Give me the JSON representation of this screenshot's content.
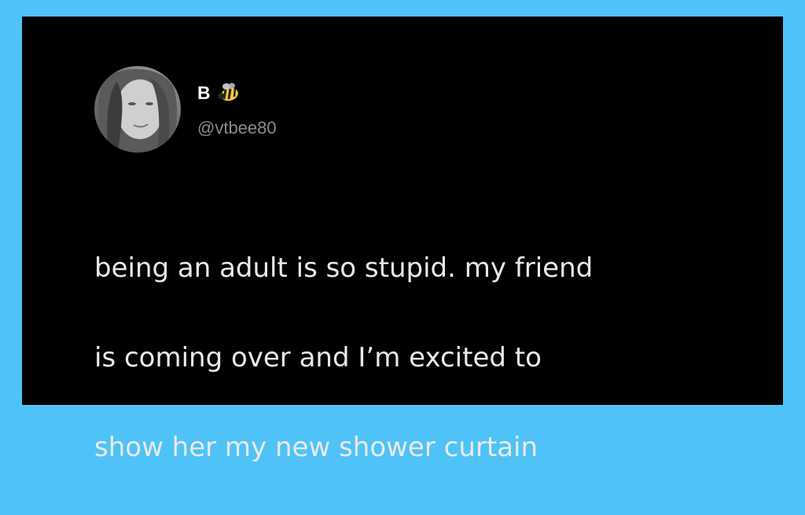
{
  "tweet": {
    "display_name": "B",
    "name_badge_icon": "bee-icon",
    "handle": "@vtbee80",
    "avatar_icon": "avatar-photo",
    "text_lines": [
      "being an adult is so stupid. my friend",
      "is coming over and I’m excited to",
      "show her my new shower curtain"
    ]
  },
  "colors": {
    "frame": "#4fc3f7",
    "card": "#000000",
    "text": "#e9e9e9",
    "handle": "#8b8b8b"
  }
}
